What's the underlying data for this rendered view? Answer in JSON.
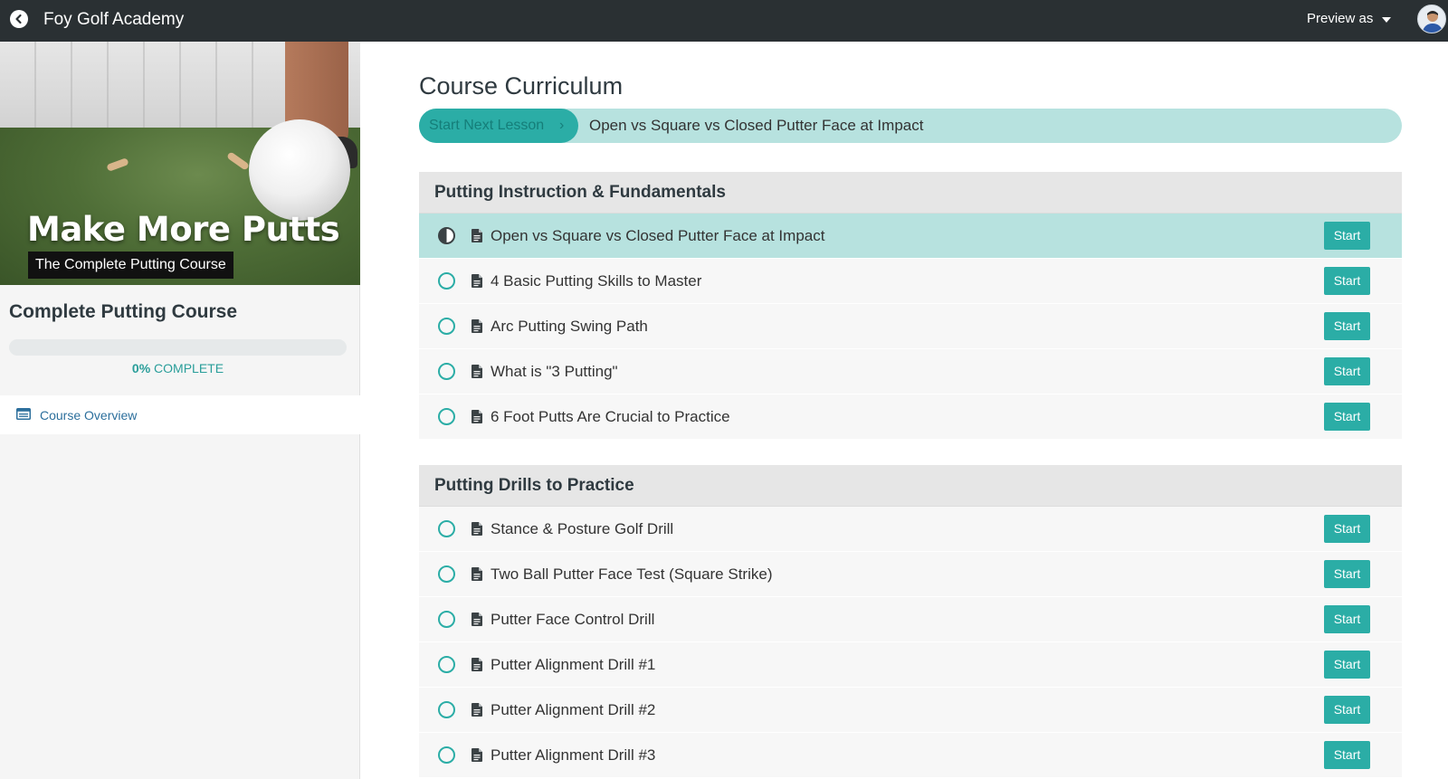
{
  "topbar": {
    "school_name": "Foy Golf Academy",
    "preview_label": "Preview as"
  },
  "sidebar": {
    "image_title": "Make More Putts",
    "image_subtitle": "The Complete Putting Course",
    "course_name": "Complete Putting Course",
    "progress_percent": 0,
    "progress_value": "0%",
    "progress_label": "COMPLETE",
    "overview_label": "Course Overview"
  },
  "main": {
    "title": "Course Curriculum",
    "next_button_label": "Start Next Lesson",
    "next_lesson_title": "Open vs Square vs Closed Putter Face at Impact",
    "sections": [
      {
        "title": "Putting Instruction & Fundamentals",
        "lessons": [
          {
            "title": "Open vs Square vs Closed Putter Face at Impact",
            "status": "in-progress",
            "action": "Start"
          },
          {
            "title": "4 Basic Putting Skills to Master",
            "status": "not-started",
            "action": "Start"
          },
          {
            "title": "Arc Putting Swing Path",
            "status": "not-started",
            "action": "Start"
          },
          {
            "title": "What is \"3 Putting\"",
            "status": "not-started",
            "action": "Start"
          },
          {
            "title": "6 Foot Putts Are Crucial to Practice",
            "status": "not-started",
            "action": "Start"
          }
        ]
      },
      {
        "title": "Putting Drills to Practice",
        "lessons": [
          {
            "title": "Stance & Posture Golf Drill",
            "status": "not-started",
            "action": "Start"
          },
          {
            "title": "Two Ball Putter Face Test (Square Strike)",
            "status": "not-started",
            "action": "Start"
          },
          {
            "title": "Putter Face Control Drill",
            "status": "not-started",
            "action": "Start"
          },
          {
            "title": "Putter Alignment Drill #1",
            "status": "not-started",
            "action": "Start"
          },
          {
            "title": "Putter Alignment Drill #2",
            "status": "not-started",
            "action": "Start"
          },
          {
            "title": "Putter Alignment Drill #3",
            "status": "not-started",
            "action": "Start"
          }
        ]
      }
    ]
  },
  "colors": {
    "accent": "#2bada6",
    "accent_light": "#b7e2df",
    "topbar": "#2a3033"
  },
  "icons": {
    "back": "back-arrow-icon",
    "preview_caret": "caret-down-icon",
    "overview": "overview-icon",
    "lesson_type": "document-icon",
    "lesson_status": "status-circle-icon",
    "next_chevron": "chevron-right-icon"
  }
}
